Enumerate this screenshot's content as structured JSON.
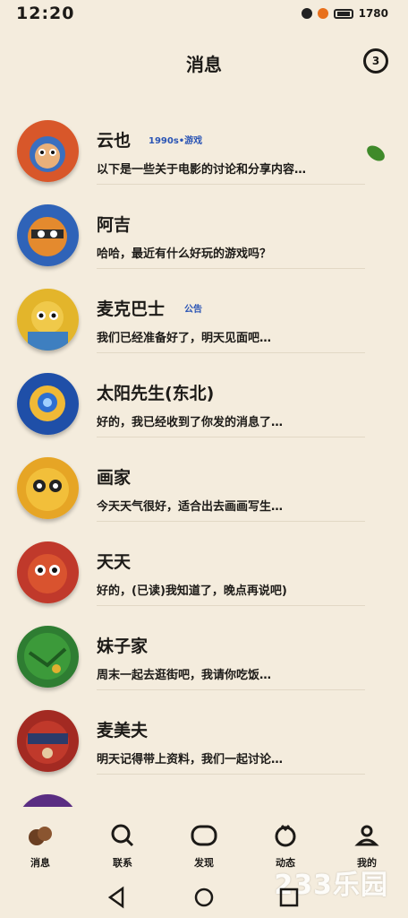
{
  "status_bar": {
    "time": "12:20",
    "battery_text": "1780"
  },
  "header": {
    "title": "消息",
    "badge": "3"
  },
  "conversations": [
    {
      "name": "云也",
      "tag": "1990s•游戏",
      "preview": "以下是一些关于电影的讨论和分享内容…"
    },
    {
      "name": "阿吉",
      "tag": "",
      "preview": "哈哈，最近有什么好玩的游戏吗？"
    },
    {
      "name": "麦克巴士",
      "tag": "公告",
      "preview": "我们已经准备好了，明天见面吧…"
    },
    {
      "name": "太阳先生(东北)",
      "tag": "",
      "preview": "好的，我已经收到了你发的消息了…"
    },
    {
      "name": "画家",
      "tag": "",
      "preview": "今天天气很好，适合出去画画写生…"
    },
    {
      "name": "天天",
      "tag": "",
      "preview": "好的，(已读)我知道了，晚点再说吧)"
    },
    {
      "name": "妹子家",
      "tag": "",
      "preview": "周末一起去逛街吧，我请你吃饭…"
    },
    {
      "name": "麦美夫",
      "tag": "",
      "preview": "明天记得带上资料，我们一起讨论…"
    },
    {
      "name": "",
      "tag": "",
      "preview": ""
    }
  ],
  "tabs": [
    {
      "label": "消息",
      "icon": "chat-bubbles-icon"
    },
    {
      "label": "联系",
      "icon": "contacts-icon"
    },
    {
      "label": "发现",
      "icon": "discover-icon"
    },
    {
      "label": "动态",
      "icon": "moments-icon"
    },
    {
      "label": "我的",
      "icon": "profile-icon"
    }
  ],
  "watermark": "233乐园",
  "colors": {
    "background": "#f4ecdd",
    "accent_blue": "#2b55b5",
    "text": "#1c1a17"
  }
}
